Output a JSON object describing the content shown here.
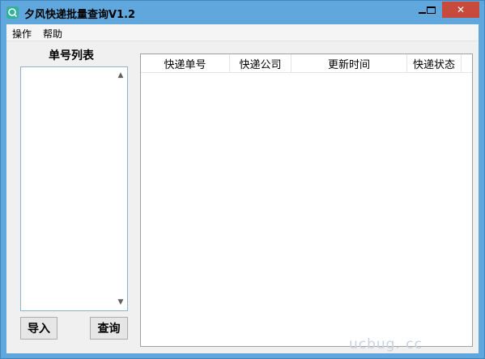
{
  "window": {
    "title": "夕风快递批量查询V1.2",
    "accent_color": "#5fa7dc",
    "app_icon": "query-app-icon",
    "controls": {
      "minimize_icon": "minimize-icon",
      "maximize_icon": "maximize-icon",
      "close_icon": "close-icon",
      "close_glyph": "✕"
    }
  },
  "menubar": {
    "items": [
      "操作",
      "帮助"
    ]
  },
  "left_panel": {
    "title": "单号列表",
    "list_items": [],
    "scroll_up_glyph": "▲",
    "scroll_down_glyph": "▼",
    "import_label": "导入",
    "query_label": "查询"
  },
  "grid": {
    "columns": [
      "快递单号",
      "快递公司",
      "更新时间",
      "快递状态"
    ],
    "rows": []
  },
  "watermark": "ucbug. cc"
}
